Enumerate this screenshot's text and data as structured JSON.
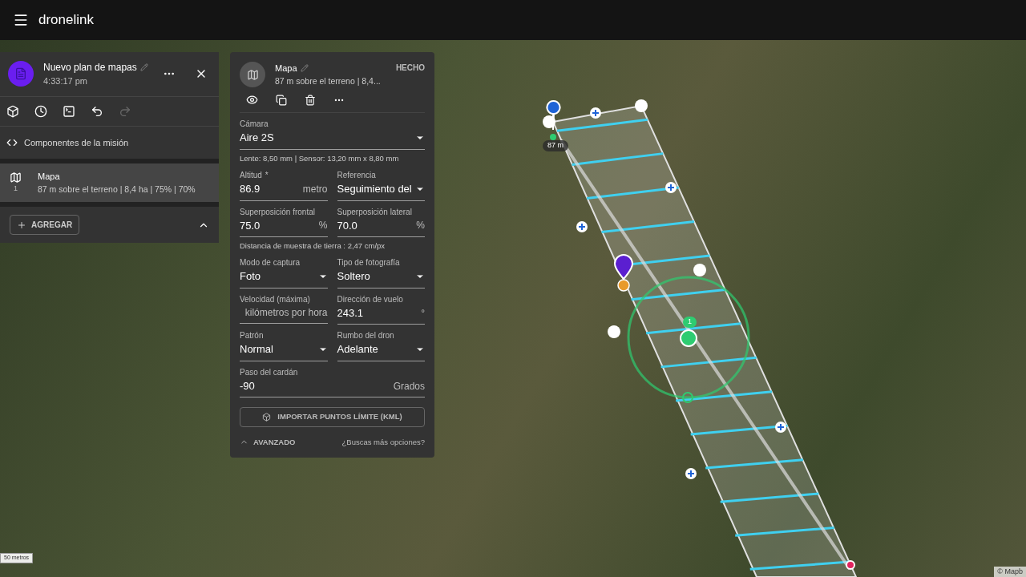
{
  "app": {
    "logo": "dronelink"
  },
  "plan": {
    "title": "Nuevo plan de mapas",
    "time": "4:33:17 pm",
    "tools": [
      {
        "disabled": false
      },
      {
        "disabled": false
      },
      {
        "disabled": false
      },
      {
        "disabled": false
      },
      {
        "disabled": true
      }
    ],
    "section": "Componentes de la misión",
    "components": [
      {
        "name": "Mapa",
        "number": "1",
        "detail": "87 m sobre el terreno | 8,4 ha | 75% | 70%",
        "selected": true
      }
    ],
    "add_button": "AGREGAR"
  },
  "editor": {
    "required_mark": "*",
    "title": "Mapa",
    "subtitle": "87 m sobre el terreno | 8,4...",
    "done": "HECHO",
    "rows": [
      {
        "fields": [
          {
            "kind": "select",
            "label": "Cámara",
            "value": "Aire 2S"
          }
        ]
      },
      {
        "note": "Lente: 8,50 mm | Sensor: 13,20 mm x 8,80 mm"
      },
      {
        "fields": [
          {
            "kind": "input",
            "label": "Altitud",
            "required": true,
            "value": "86.9",
            "unit": "metro"
          },
          {
            "kind": "select",
            "label": "Referencia",
            "value": "Seguimiento del"
          }
        ]
      },
      {
        "fields": [
          {
            "kind": "input",
            "label": "Superposición frontal",
            "value": "75.0",
            "unit": "%"
          },
          {
            "kind": "input",
            "label": "Superposición lateral",
            "value": "70.0",
            "unit": "%"
          }
        ]
      },
      {
        "note": "Distancia de muestra de tierra : 2,47 cm/px"
      },
      {
        "fields": [
          {
            "kind": "select",
            "label": "Modo de captura",
            "value": "Foto"
          },
          {
            "kind": "select",
            "label": "Tipo de fotografía",
            "value": "Soltero"
          }
        ]
      },
      {
        "fields": [
          {
            "kind": "input",
            "label": "Velocidad (máxima)",
            "unit": "kilómetros por hora"
          },
          {
            "kind": "input",
            "label": "Dirección de vuelo",
            "value": "243.1",
            "unit": "°"
          }
        ]
      },
      {
        "fields": [
          {
            "kind": "select",
            "label": "Patrón",
            "value": "Normal"
          },
          {
            "kind": "select",
            "label": "Rumbo del dron",
            "value": "Adelante"
          }
        ]
      },
      {
        "fields": [
          {
            "kind": "input",
            "label": "Paso del cardán",
            "value": "-90",
            "unit": "Grados"
          }
        ]
      }
    ],
    "import_button": "IMPORTAR PUNTOS LÍMITE (KML)",
    "advanced": "AVANZADO",
    "more_link": "¿Buscas más opciones?"
  },
  "map": {
    "altitude_label": "87 m",
    "waypoint_badge": "1",
    "scale": "50 metros",
    "attribution": "© Mapb"
  }
}
